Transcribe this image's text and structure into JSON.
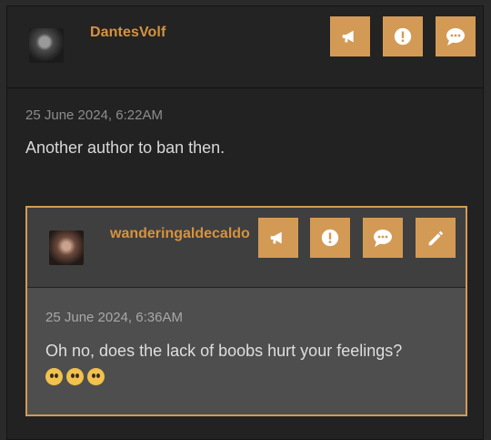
{
  "top_comment": {
    "username": "DantesVolf",
    "avatar_icon": "user-avatar-icon",
    "timestamp": "25 June 2024, 6:22AM",
    "text": "Another author to ban then.",
    "actions": [
      {
        "icon": "megaphone-icon"
      },
      {
        "icon": "exclamation-icon"
      },
      {
        "icon": "chat-icon"
      }
    ]
  },
  "reply": {
    "username": "wanderingaldecaldo",
    "avatar_icon": "user-avatar-icon",
    "timestamp": "25 June 2024, 6:36AM",
    "text": "Oh no, does the lack of boobs hurt your feelings?",
    "emoji": [
      "pleading-face",
      "pleading-face",
      "pleading-face"
    ],
    "actions": [
      {
        "icon": "megaphone-icon"
      },
      {
        "icon": "exclamation-icon"
      },
      {
        "icon": "chat-icon"
      },
      {
        "icon": "pencil-icon"
      }
    ]
  },
  "colors": {
    "accent": "#d39a55",
    "username": "#d8923d",
    "background": "#222222",
    "reply_background": "#4e4e4e"
  }
}
